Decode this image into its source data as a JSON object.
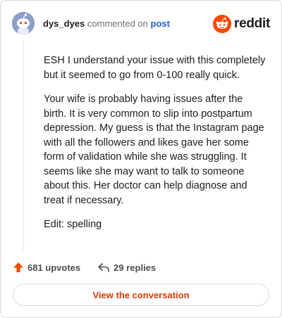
{
  "header": {
    "username": "dys_dyes",
    "action_text": "commented on",
    "post_link": "post",
    "logo_text": "reddit"
  },
  "comment": {
    "paragraphs": [
      "ESH I understand your issue with this completely but it seemed to go from 0-100 really quick.",
      "Your wife is probably having issues after the birth. It is very common to slip into postpartum depression. My guess is that the Instagram page with all the followers and likes gave her some form of validation while she was struggling. It seems like she may want to talk to someone about this. Her doctor can help diagnose and treat if necessary.",
      "Edit: spelling"
    ]
  },
  "actions": {
    "upvotes": "681 upvotes",
    "replies": "29 replies"
  },
  "footer": {
    "view_label": "View the conversation"
  },
  "icons": {
    "avatar": "snoo-avatar-icon",
    "logo": "reddit-logo-icon",
    "upvote": "upvote-arrow-icon",
    "reply": "reply-arrow-icon"
  },
  "colors": {
    "brand_orange": "#ff4500",
    "link_blue": "#1c5fc6",
    "button_text": "#d63a04"
  }
}
